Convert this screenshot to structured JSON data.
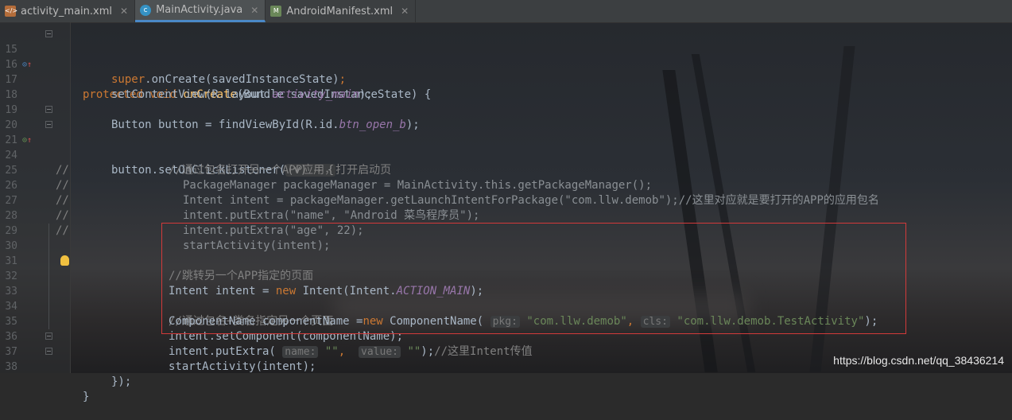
{
  "tabs": [
    {
      "label": "activity_main.xml",
      "icon": "xml-file-icon",
      "active": false
    },
    {
      "label": "MainActivity.java",
      "icon": "java-class-icon",
      "active": true
    },
    {
      "label": "AndroidManifest.xml",
      "icon": "manifest-file-icon",
      "active": false
    }
  ],
  "gutter": {
    "line_numbers": [
      "15",
      "16",
      "17",
      "18",
      "19",
      "20",
      "21",
      "24",
      "25",
      "26",
      "27",
      "28",
      "29",
      "30",
      "31",
      "32",
      "33",
      "34",
      "35",
      "36",
      "37",
      "38"
    ]
  },
  "code": {
    "l15": {
      "kw1": "protected",
      "kw2": "void",
      "fn": "onCreate",
      "rest": "(Bundle savedInstanceState) {"
    },
    "l16": {
      "kw": "super",
      "rest1": ".onCreate(savedInstanceState)",
      "semi": ";"
    },
    "l17": {
      "rest1": "setContentView(R.layout.",
      "it": "activity_main",
      "rest2": ");"
    },
    "l19": {
      "rest1": "Button button = findViewById(R.id.",
      "it": "btn_open_b",
      "rest2": ");"
    },
    "l20": {
      "rest1": "button.setOnClickListener(",
      "lam": "(v) → {"
    },
    "l21": {
      "cm": "//通过包名打开另一个APP应用，打开启动页"
    },
    "l24": {
      "slash": "//",
      "text": "PackageManager packageManager = MainActivity.this.getPackageManager();"
    },
    "l25": {
      "slash": "//",
      "text": "Intent intent = packageManager.getLaunchIntentForPackage(\"com.llw.demob\");//这里对应就是要打开的APP的应用包名"
    },
    "l26": {
      "slash": "//",
      "text": "intent.putExtra(\"name\", \"Android 菜鸟程序员\");"
    },
    "l27": {
      "slash": "//",
      "text": "intent.putExtra(\"age\", 22);"
    },
    "l28": {
      "slash": "//",
      "text": "startActivity(intent);"
    },
    "l30": {
      "cm": "//跳转另一个APP指定的页面"
    },
    "l31": {
      "rest1": "Intent intent = ",
      "kw": "new",
      "rest2": " Intent(Intent.",
      "it": "ACTION_MAIN",
      "rest3": ");"
    },
    "l32": {
      "cm": "//通过包名+类名指定另一个页面"
    },
    "l33": {
      "rest1": "ComponentName componentName =",
      "kw": "new",
      "rest2": " ComponentName( ",
      "hint1": "pkg:",
      "str1": "\"com.llw.demob\"",
      "comma": ", ",
      "hint2": "cls:",
      "str2": "\"com.llw.demob.TestActivity\"",
      "rest3": ");"
    },
    "l34": {
      "rest1": "intent.setComponent(componentName);"
    },
    "l35": {
      "rest1": "intent.putExtra( ",
      "hint1": "name:",
      "str1": "\"\"",
      "comma": ",  ",
      "hint2": "value:",
      "str2": "\"\"",
      "rest2": ");",
      "cm": "//这里Intent传值"
    },
    "l36": {
      "rest1": "startActivity(intent);"
    },
    "l37": {
      "rest1": "});"
    },
    "l38": {
      "rest1": "}"
    }
  },
  "watermark": "https://blog.csdn.net/qq_38436214",
  "colors": {
    "keyword": "#cc7832",
    "function": "#ffc66d",
    "string": "#6a8759",
    "field": "#9876aa",
    "comment": "#808080",
    "highlight_box": "#d23a3a"
  }
}
